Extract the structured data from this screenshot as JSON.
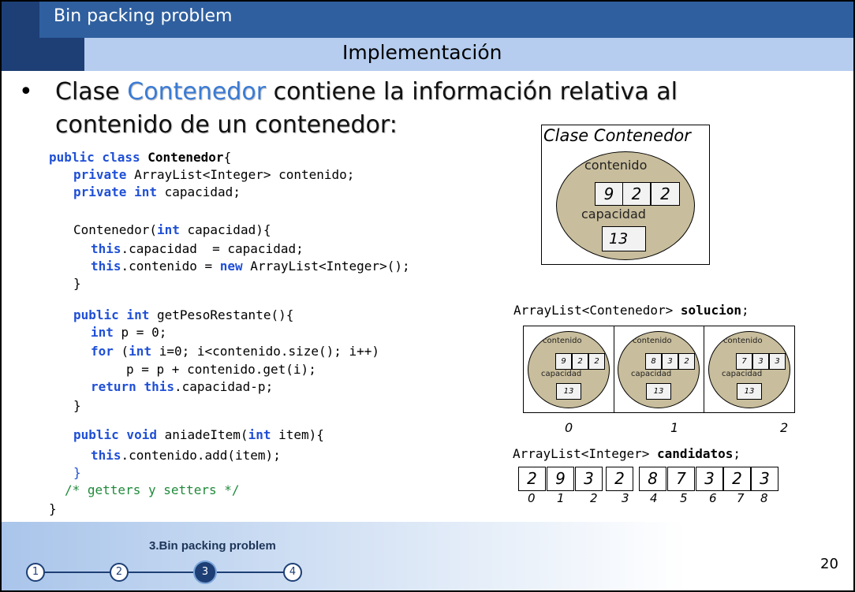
{
  "header": {
    "title": "Bin packing problem",
    "subtitle": "Implementación"
  },
  "bullet": {
    "marker": "•",
    "text_before": "Clase ",
    "highlight": "Contenedor",
    "text_after": " contiene la información relativa al contenido de un contenedor:"
  },
  "code": {
    "line1_kw": "public class",
    "line1_name": "Contenedor",
    "line1_rest": "{",
    "line2_kw1": "private",
    "line2_rest": " ArrayList<Integer> contenido;",
    "line3_kw1": "private",
    "line3_kw2": "int",
    "line3_rest": " capacidad;",
    "line4_a": "Contenedor(",
    "line4_kw": "int",
    "line4_b": " capacidad){",
    "line5_kw": "this",
    "line5_rest": ".capacidad  = capacidad;",
    "line6_kw": "this",
    "line6_a": ".contenido = ",
    "line6_kw2": "new",
    "line6_b": " ArrayList<Integer>();",
    "line7": "}",
    "line8_kw": "public int",
    "line8_rest": " getPesoRestante(){",
    "line9_kw": "int",
    "line9_rest": " p = 0;",
    "line10_kw": "for",
    "line10_a": " (",
    "line10_kw2": "int",
    "line10_b": " i=0; i<contenido.size(); i++)",
    "line11": "p = p + contenido.get(i);",
    "line12_kw": "return",
    "line12_kw2": "this",
    "line12_rest": ".capacidad-p;",
    "line13": "}",
    "line14_kw": "public void",
    "line14_a": " aniadeItem(",
    "line14_kw2": "int",
    "line14_b": " item){",
    "line15_kw": "this",
    "line15_rest": ".contenido.add(item);",
    "line16": "}",
    "line17": "/* getters y setters */",
    "line18": "}"
  },
  "class_diagram": {
    "caption": "Clase Contenedor",
    "contenido_label": "contenido",
    "contenido_values": [
      "9",
      "2",
      "2"
    ],
    "capacidad_label": "capacidad",
    "capacidad_value": "13"
  },
  "solucion": {
    "label_type": "ArrayList<Contenedor> ",
    "label_name": "solucion",
    "label_end": ";",
    "bins": [
      {
        "contenido_label": "contenido",
        "values": [
          "9",
          "2",
          "2"
        ],
        "capacidad_label": "capacidad",
        "capacidad": "13",
        "index": "0"
      },
      {
        "contenido_label": "contenido",
        "values": [
          "8",
          "3",
          "2"
        ],
        "capacidad_label": "capacidad",
        "capacidad": "13",
        "index": "1"
      },
      {
        "contenido_label": "contenido",
        "values": [
          "7",
          "3",
          "3"
        ],
        "capacidad_label": "capacidad",
        "capacidad": "13",
        "index": "2"
      }
    ]
  },
  "candidatos": {
    "label_type": "ArrayList<Integer> ",
    "label_name": "candidatos",
    "label_end": ";",
    "values": [
      "2",
      "9",
      "3",
      "2",
      "8",
      "7",
      "3",
      "2",
      "3"
    ],
    "indices": [
      "0",
      "1",
      "2",
      "3",
      "4",
      "5",
      "6",
      "7",
      "8"
    ]
  },
  "footer": {
    "section": "3.Bin packing problem",
    "steps": [
      "1",
      "2",
      "3",
      "4"
    ],
    "active_step": 3,
    "page_number": "20"
  }
}
